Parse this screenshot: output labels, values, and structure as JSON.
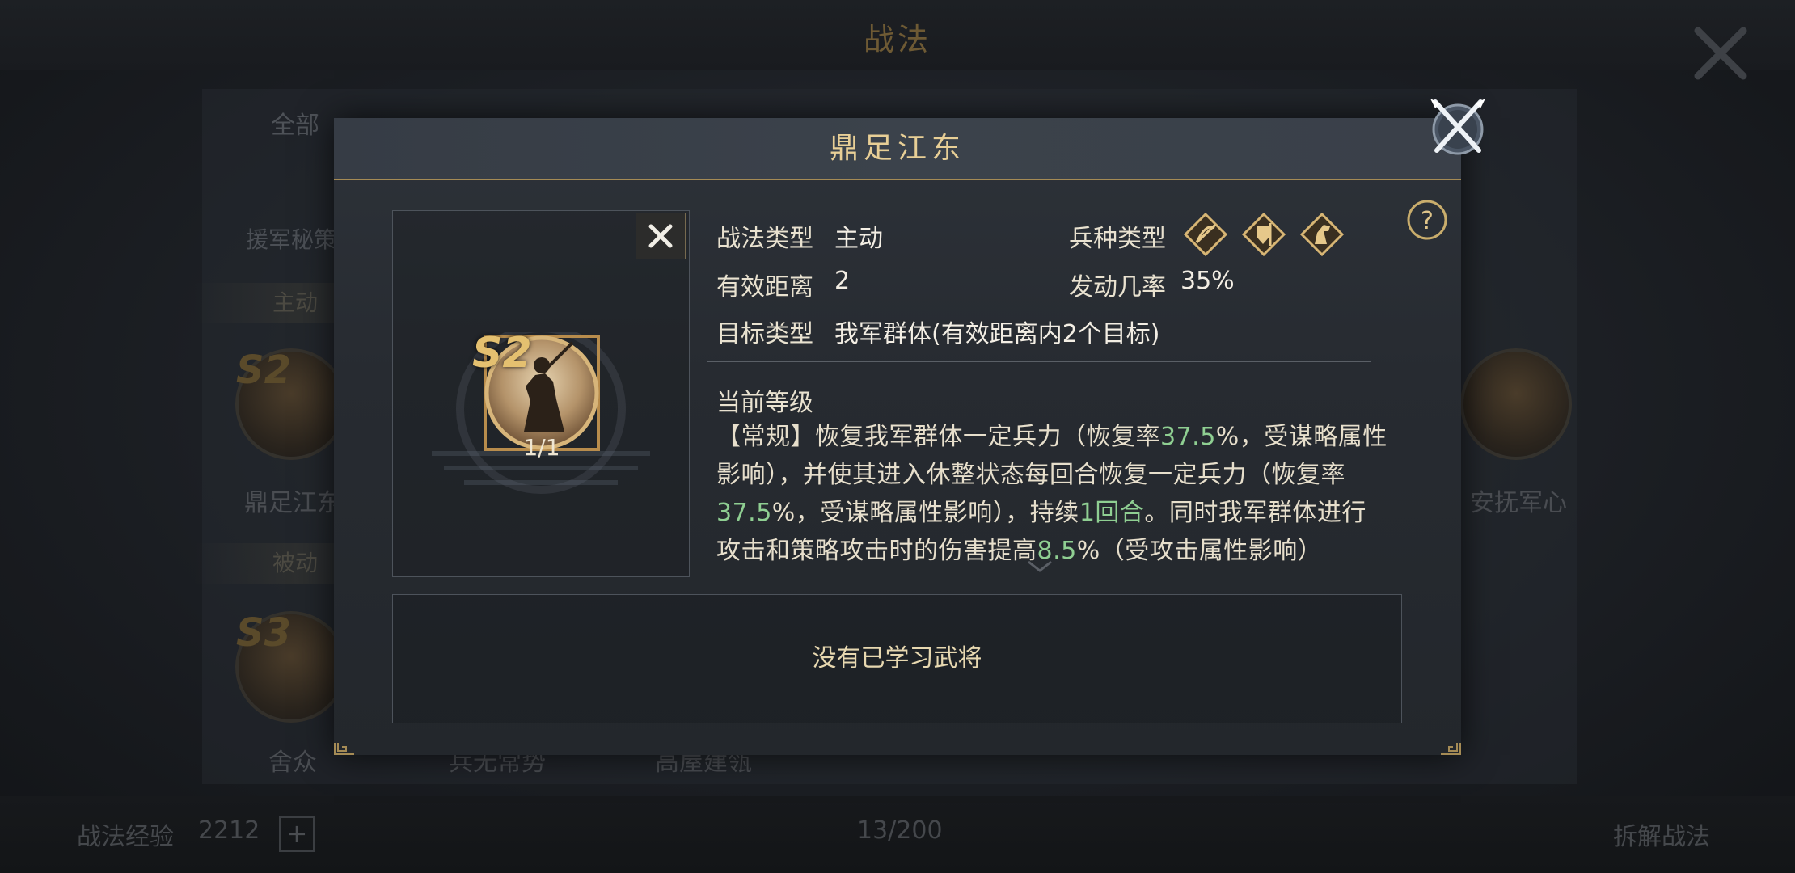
{
  "background": {
    "title": "战法",
    "tab_all": "全部",
    "side_labels": [
      "援军秘策"
    ],
    "categories": [
      "主动",
      "被动"
    ],
    "cards": [
      {
        "grade": "S2",
        "name": "鼎足江东"
      },
      {
        "grade": "S3",
        "name": "舍众"
      },
      {
        "grade": "",
        "name": "兵无常势"
      },
      {
        "grade": "",
        "name": "高屋建瓴"
      },
      {
        "grade": "",
        "name": "安抚军心"
      }
    ],
    "bottom": {
      "exp_label": "战法经验",
      "exp_value": "2212",
      "plus": "+",
      "page": "13/200",
      "decompose": "拆解战法"
    }
  },
  "dialog": {
    "title": "鼎足江东",
    "skill": {
      "grade": "S2",
      "count": "1/1"
    },
    "tactic_type_label": "战法类型",
    "tactic_type_value": "主动",
    "troop_type_label": "兵种类型",
    "troop_icons": [
      "bow-cavalry-icon",
      "shield-infantry-icon",
      "horse-cavalry-icon"
    ],
    "range_label": "有效距离",
    "range_value": "2",
    "rate_label": "发动几率",
    "rate_value": "35%",
    "target_label": "目标类型",
    "target_value": "我军群体(有效距离内2个目标)",
    "level_title": "当前等级",
    "description": [
      {
        "t": "【常规】恢复我军群体一定兵力（恢复率",
        "h": false
      },
      {
        "t": "37.5",
        "h": true
      },
      {
        "t": "%，受谋略属性影响），并使其进入休整状态每回合恢复一定兵力（恢复率",
        "h": false
      },
      {
        "t": "37.5",
        "h": true
      },
      {
        "t": "%，受谋略属性影响），持续",
        "h": false
      },
      {
        "t": "1回合",
        "h": true
      },
      {
        "t": "。同时我军群体进行攻击和策略攻击时的伤害提高",
        "h": false
      },
      {
        "t": "8.5",
        "h": true
      },
      {
        "t": "%（受攻击属性影响）",
        "h": false
      }
    ],
    "no_generals": "没有已学习武将",
    "colors": {
      "gold": "#e8cf96",
      "highlight": "#8fcf92",
      "border": "#a58b55"
    }
  }
}
